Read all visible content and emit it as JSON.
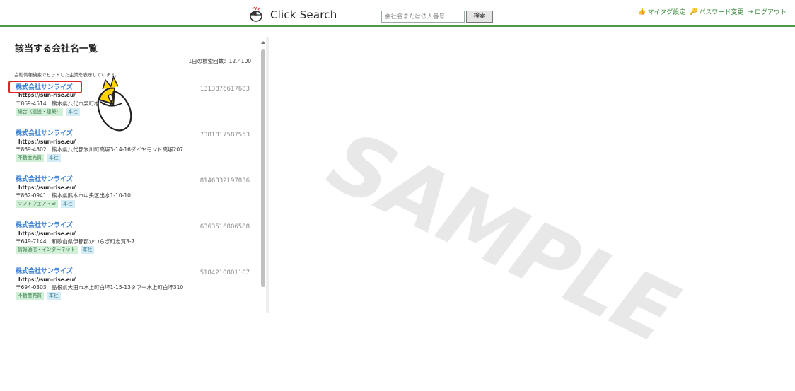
{
  "header": {
    "app_name": "Click Search",
    "search": {
      "placeholder": "会社名または法人番号",
      "button_label": "検索"
    },
    "links": [
      {
        "label": "マイタグ設定",
        "icon": "thumb-up-icon"
      },
      {
        "label": "パスワード変更",
        "icon": "key-icon"
      },
      {
        "label": "ログアウト",
        "icon": "logout-icon"
      }
    ],
    "accent_color": "#4a9a48"
  },
  "panel": {
    "title": "該当する会社名一覧",
    "quota": "1日の検索回数：12／100",
    "notice": "会社情報検索でヒットした企業を表示しています。",
    "items": [
      {
        "name": "株式会社サンライズ",
        "corp_no": "1313876617683",
        "url": "https://sun-rise.eu/",
        "address": "〒869-4514　熊本県八代市泉町椎原2-13",
        "industry": "総合（建設・建築）",
        "branch": "本社"
      },
      {
        "name": "株式会社サンライズ",
        "corp_no": "7381817587553",
        "url": "https://sun-rise.eu/",
        "address": "〒869-4802　熊本県八代郡氷川町高塚3-14-16ダイヤモンド高塚207",
        "industry": "不動産売買",
        "branch": "本社"
      },
      {
        "name": "株式会社サンライズ",
        "corp_no": "8146332197836",
        "url": "https://sun-rise.eu/",
        "address": "〒862-0941　熊本県熊本市中央区出水1-10-10",
        "industry": "ソフトウェア・SI",
        "branch": "本社"
      },
      {
        "name": "株式会社サンライズ",
        "corp_no": "6363516806588",
        "url": "https://sun-rise.eu/",
        "address": "〒649-7144　和歌山県伊都郡かつらぎ町志賀3-7",
        "industry": "情報通信・インターネット",
        "branch": "本社"
      },
      {
        "name": "株式会社サンライズ",
        "corp_no": "5184210801107",
        "url": "https://sun-rise.eu/",
        "address": "〒694-0303　島根県大田市水上町白坏1-15-13タワー水上町白坏310",
        "industry": "不動産売買",
        "branch": "本社"
      }
    ]
  },
  "watermark": "SAMPLE",
  "highlight_color": "#e0242b"
}
